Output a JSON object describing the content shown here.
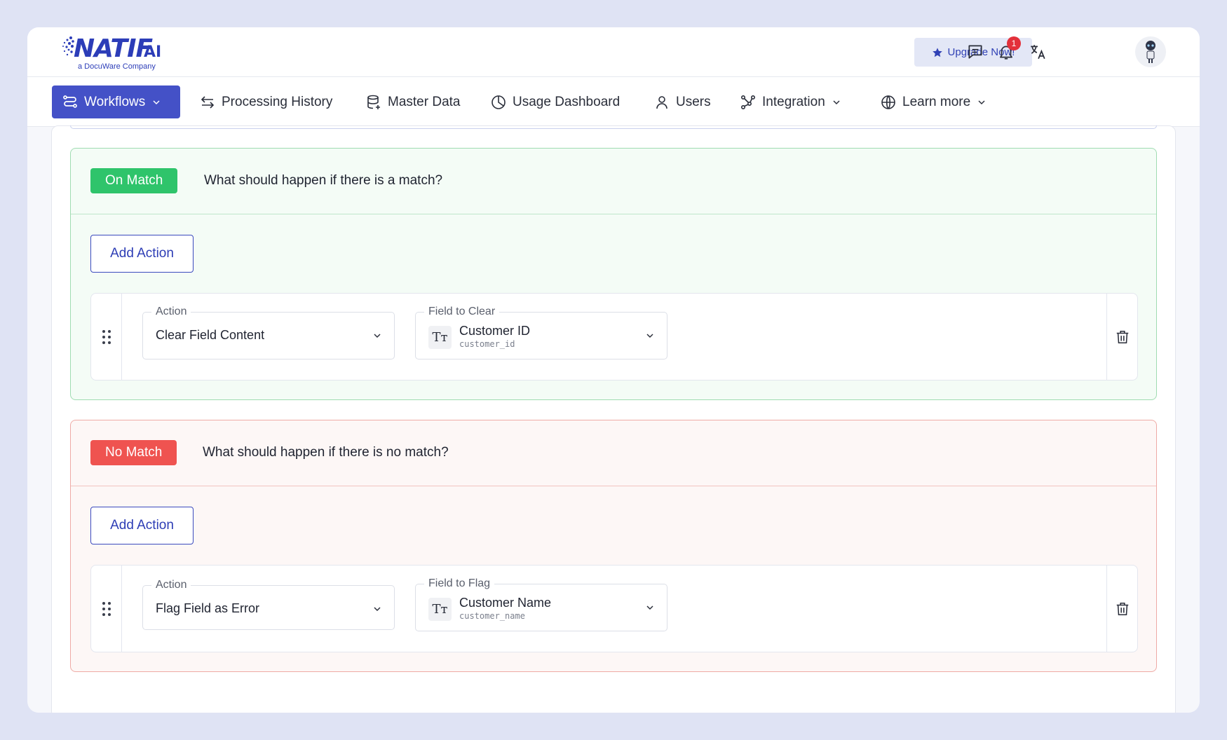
{
  "brand": {
    "name": "NATIF",
    "suffix": "AI",
    "tagline": "a DocuWare Company",
    "color": "#2c3db8"
  },
  "header": {
    "upgrade_label": "Upgrade Now!",
    "notification_count": "1"
  },
  "nav": {
    "workflows": "Workflows",
    "processing_history": "Processing History",
    "master_data": "Master Data",
    "usage_dashboard": "Usage Dashboard",
    "users": "Users",
    "integration": "Integration",
    "learn_more": "Learn more"
  },
  "on_match": {
    "pill": "On Match",
    "question": "What should happen if there is a match?",
    "add_action": "Add Action",
    "action": {
      "label": "Action",
      "value": "Clear Field Content"
    },
    "field": {
      "label": "Field to Clear",
      "name": "Customer ID",
      "key": "customer_id",
      "type_icon": "Tт"
    }
  },
  "no_match": {
    "pill": "No Match",
    "question": "What should happen if there is no match?",
    "add_action": "Add Action",
    "action": {
      "label": "Action",
      "value": "Flag Field as Error"
    },
    "field": {
      "label": "Field to Flag",
      "name": "Customer Name",
      "key": "customer_name",
      "type_icon": "Tт"
    }
  },
  "colors": {
    "accent": "#4451c7",
    "match": "#2fc46b",
    "no_match": "#ef5350"
  }
}
